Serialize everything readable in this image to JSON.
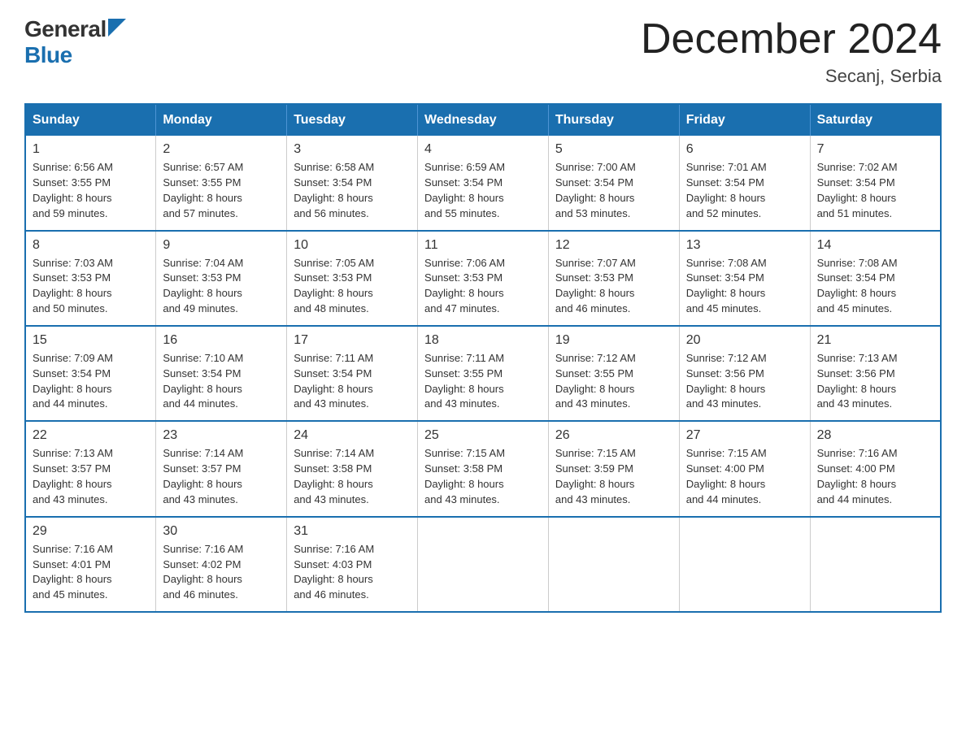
{
  "logo": {
    "general": "General",
    "blue": "Blue"
  },
  "title": "December 2024",
  "location": "Secanj, Serbia",
  "days_of_week": [
    "Sunday",
    "Monday",
    "Tuesday",
    "Wednesday",
    "Thursday",
    "Friday",
    "Saturday"
  ],
  "weeks": [
    [
      {
        "day": "1",
        "sunrise": "6:56 AM",
        "sunset": "3:55 PM",
        "daylight": "8 hours and 59 minutes."
      },
      {
        "day": "2",
        "sunrise": "6:57 AM",
        "sunset": "3:55 PM",
        "daylight": "8 hours and 57 minutes."
      },
      {
        "day": "3",
        "sunrise": "6:58 AM",
        "sunset": "3:54 PM",
        "daylight": "8 hours and 56 minutes."
      },
      {
        "day": "4",
        "sunrise": "6:59 AM",
        "sunset": "3:54 PM",
        "daylight": "8 hours and 55 minutes."
      },
      {
        "day": "5",
        "sunrise": "7:00 AM",
        "sunset": "3:54 PM",
        "daylight": "8 hours and 53 minutes."
      },
      {
        "day": "6",
        "sunrise": "7:01 AM",
        "sunset": "3:54 PM",
        "daylight": "8 hours and 52 minutes."
      },
      {
        "day": "7",
        "sunrise": "7:02 AM",
        "sunset": "3:54 PM",
        "daylight": "8 hours and 51 minutes."
      }
    ],
    [
      {
        "day": "8",
        "sunrise": "7:03 AM",
        "sunset": "3:53 PM",
        "daylight": "8 hours and 50 minutes."
      },
      {
        "day": "9",
        "sunrise": "7:04 AM",
        "sunset": "3:53 PM",
        "daylight": "8 hours and 49 minutes."
      },
      {
        "day": "10",
        "sunrise": "7:05 AM",
        "sunset": "3:53 PM",
        "daylight": "8 hours and 48 minutes."
      },
      {
        "day": "11",
        "sunrise": "7:06 AM",
        "sunset": "3:53 PM",
        "daylight": "8 hours and 47 minutes."
      },
      {
        "day": "12",
        "sunrise": "7:07 AM",
        "sunset": "3:53 PM",
        "daylight": "8 hours and 46 minutes."
      },
      {
        "day": "13",
        "sunrise": "7:08 AM",
        "sunset": "3:54 PM",
        "daylight": "8 hours and 45 minutes."
      },
      {
        "day": "14",
        "sunrise": "7:08 AM",
        "sunset": "3:54 PM",
        "daylight": "8 hours and 45 minutes."
      }
    ],
    [
      {
        "day": "15",
        "sunrise": "7:09 AM",
        "sunset": "3:54 PM",
        "daylight": "8 hours and 44 minutes."
      },
      {
        "day": "16",
        "sunrise": "7:10 AM",
        "sunset": "3:54 PM",
        "daylight": "8 hours and 44 minutes."
      },
      {
        "day": "17",
        "sunrise": "7:11 AM",
        "sunset": "3:54 PM",
        "daylight": "8 hours and 43 minutes."
      },
      {
        "day": "18",
        "sunrise": "7:11 AM",
        "sunset": "3:55 PM",
        "daylight": "8 hours and 43 minutes."
      },
      {
        "day": "19",
        "sunrise": "7:12 AM",
        "sunset": "3:55 PM",
        "daylight": "8 hours and 43 minutes."
      },
      {
        "day": "20",
        "sunrise": "7:12 AM",
        "sunset": "3:56 PM",
        "daylight": "8 hours and 43 minutes."
      },
      {
        "day": "21",
        "sunrise": "7:13 AM",
        "sunset": "3:56 PM",
        "daylight": "8 hours and 43 minutes."
      }
    ],
    [
      {
        "day": "22",
        "sunrise": "7:13 AM",
        "sunset": "3:57 PM",
        "daylight": "8 hours and 43 minutes."
      },
      {
        "day": "23",
        "sunrise": "7:14 AM",
        "sunset": "3:57 PM",
        "daylight": "8 hours and 43 minutes."
      },
      {
        "day": "24",
        "sunrise": "7:14 AM",
        "sunset": "3:58 PM",
        "daylight": "8 hours and 43 minutes."
      },
      {
        "day": "25",
        "sunrise": "7:15 AM",
        "sunset": "3:58 PM",
        "daylight": "8 hours and 43 minutes."
      },
      {
        "day": "26",
        "sunrise": "7:15 AM",
        "sunset": "3:59 PM",
        "daylight": "8 hours and 43 minutes."
      },
      {
        "day": "27",
        "sunrise": "7:15 AM",
        "sunset": "4:00 PM",
        "daylight": "8 hours and 44 minutes."
      },
      {
        "day": "28",
        "sunrise": "7:16 AM",
        "sunset": "4:00 PM",
        "daylight": "8 hours and 44 minutes."
      }
    ],
    [
      {
        "day": "29",
        "sunrise": "7:16 AM",
        "sunset": "4:01 PM",
        "daylight": "8 hours and 45 minutes."
      },
      {
        "day": "30",
        "sunrise": "7:16 AM",
        "sunset": "4:02 PM",
        "daylight": "8 hours and 46 minutes."
      },
      {
        "day": "31",
        "sunrise": "7:16 AM",
        "sunset": "4:03 PM",
        "daylight": "8 hours and 46 minutes."
      },
      null,
      null,
      null,
      null
    ]
  ]
}
